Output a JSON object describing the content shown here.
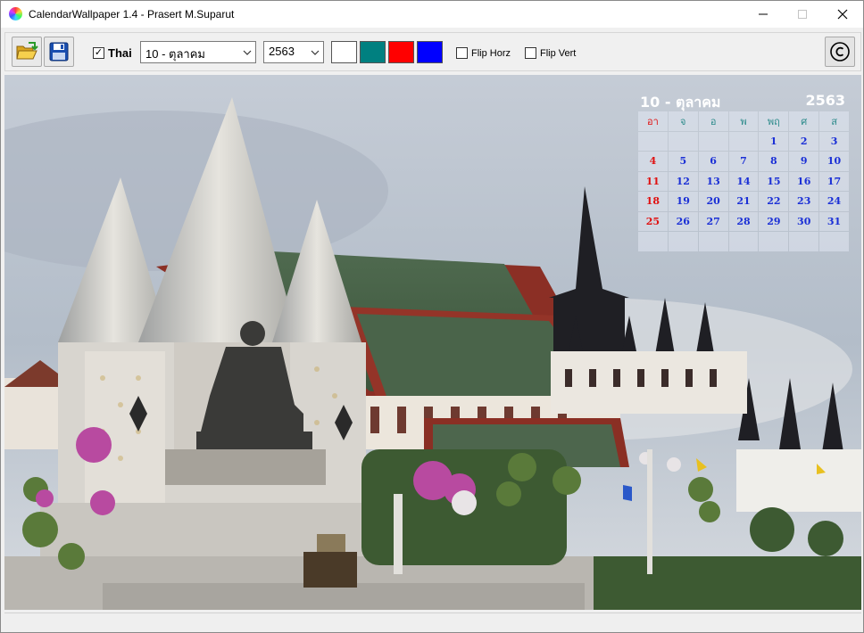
{
  "window": {
    "title": "CalendarWallpaper 1.4 - Prasert M.Suparut",
    "minimize_icon": "minimize-icon",
    "maximize_icon": "maximize-icon",
    "close_icon": "close-icon"
  },
  "toolbar": {
    "open_icon": "folder-open-icon",
    "save_icon": "floppy-disk-icon",
    "thai_label": "Thai",
    "thai_checked": true,
    "month_value": "10 - ตุลาคม",
    "year_value": "2563",
    "colors": [
      "#ffffff",
      "#008080",
      "#ff0000",
      "#0000ff"
    ],
    "flip_horz_label": "Flip Horz",
    "flip_horz_checked": false,
    "flip_vert_label": "Flip Vert",
    "flip_vert_checked": false,
    "about_icon": "copyright-icon"
  },
  "calendar": {
    "month_title": "10 - ตุลาคม",
    "year": "2563",
    "weekdays": [
      "อา",
      "จ",
      "อ",
      "พ",
      "พฤ",
      "ศ",
      "ส"
    ],
    "weeks": [
      [
        "",
        "",
        "",
        "",
        "1",
        "2",
        "3"
      ],
      [
        "4",
        "5",
        "6",
        "7",
        "8",
        "9",
        "10"
      ],
      [
        "11",
        "12",
        "13",
        "14",
        "15",
        "16",
        "17"
      ],
      [
        "18",
        "19",
        "20",
        "21",
        "22",
        "23",
        "24"
      ],
      [
        "25",
        "26",
        "27",
        "28",
        "29",
        "30",
        "31"
      ],
      [
        "",
        "",
        "",
        "",
        "",
        "",
        ""
      ]
    ]
  }
}
